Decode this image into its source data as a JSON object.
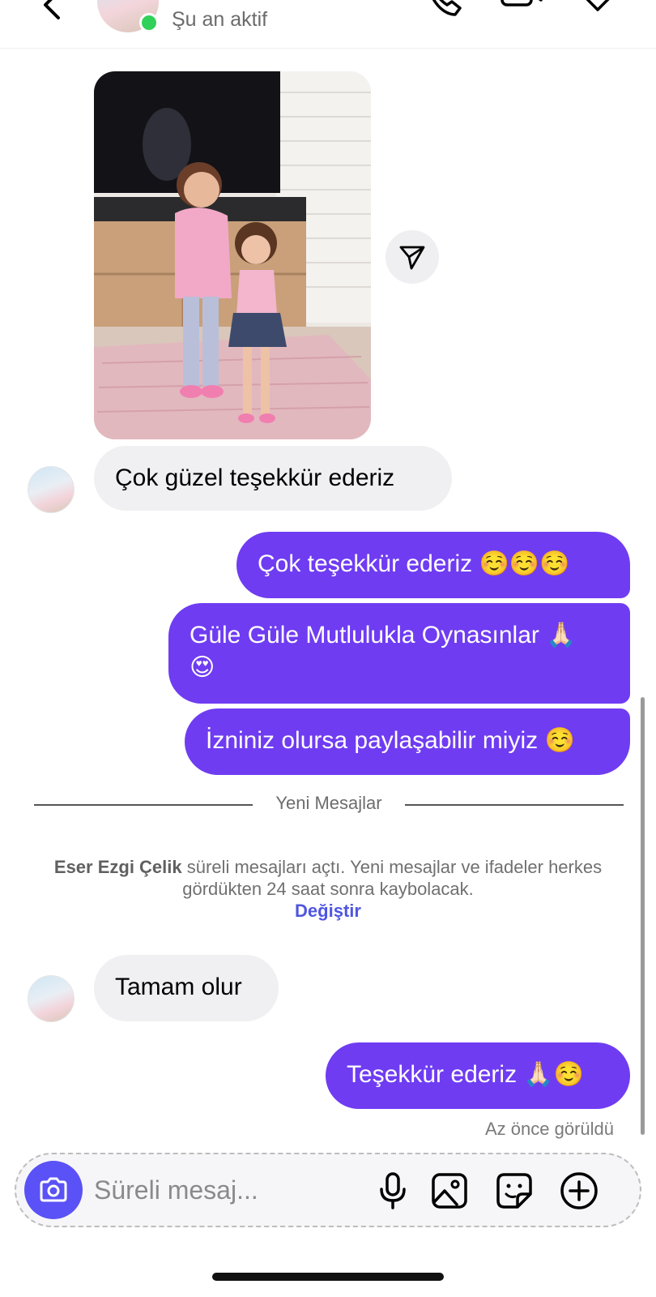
{
  "header": {
    "status": "Şu an aktif"
  },
  "messages": {
    "in_1": "Çok güzel teşekkür ederiz",
    "out_1": "Çok teşekkür ederiz ☺️☺️☺️",
    "out_2_line1": "Güle Güle Mutlulukla Oynasınlar 🙏🏻",
    "out_2_line2": "😍",
    "out_3": "İzniniz olursa paylaşabilir miyiz ☺️",
    "in_2": "Tamam olur",
    "out_4": "Teşekkür ederiz 🙏🏻☺️"
  },
  "divider": {
    "label": "Yeni Mesajlar"
  },
  "system_notice": {
    "name": "Eser Ezgi Çelik",
    "text": " süreli mesajları açtı. Yeni mesajlar ve ifadeler herkes gördükten 24 saat sonra kaybolacak.",
    "action": "Değiştir"
  },
  "seen_status": "Az önce görüldü",
  "composer": {
    "placeholder": "Süreli mesaj..."
  },
  "colors": {
    "outgoing": "#6f3cf2",
    "incoming": "#f0f0f2",
    "accent": "#5a52f6",
    "link": "#4f56e0",
    "online": "#30d158"
  },
  "icons": [
    "back-icon",
    "phone-icon",
    "video-icon",
    "tag-icon",
    "send-icon",
    "camera-icon",
    "microphone-icon",
    "image-icon",
    "sticker-icon",
    "plus-icon"
  ]
}
